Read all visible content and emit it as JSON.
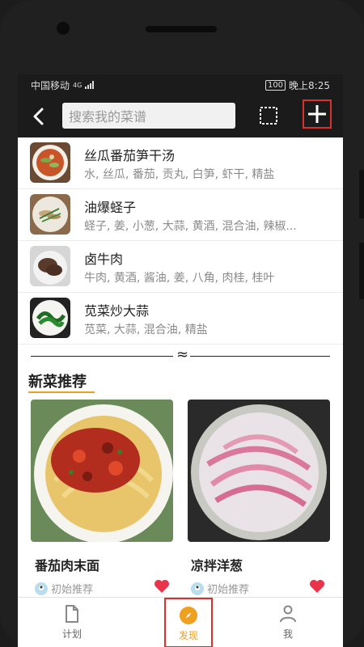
{
  "status": {
    "carrier": "中国移动",
    "network": "4G",
    "battery": "100",
    "time": "晚上8:25"
  },
  "toolbar": {
    "search_placeholder": "搜索我的菜谱"
  },
  "recipes": [
    {
      "title": "丝瓜番茄笋干汤",
      "ingredients": "水, 丝瓜, 番茄, 贡丸, 白笋, 虾干, 精盐"
    },
    {
      "title": "油爆蛏子",
      "ingredients": "蛏子, 姜, 小葱, 大蒜, 黄酒, 混合油, 辣椒..."
    },
    {
      "title": "卤牛肉",
      "ingredients": "牛肉, 黄酒, 酱油, 姜, 八角, 肉桂, 桂叶"
    },
    {
      "title": "苋菜炒大蒜",
      "ingredients": "苋菜, 大蒜, 混合油, 精盐"
    }
  ],
  "section": {
    "title": "新菜推荐"
  },
  "cards": [
    {
      "title": "番茄肉末面",
      "author": "初始推荐"
    },
    {
      "title": "凉拌洋葱",
      "author": "初始推荐"
    }
  ],
  "tabs": [
    {
      "label": "计划",
      "icon": "document-icon"
    },
    {
      "label": "发现",
      "icon": "compass-icon"
    },
    {
      "label": "我",
      "icon": "person-icon"
    }
  ],
  "colors": {
    "accent": "#f0a020",
    "highlight": "#d9322d",
    "toolbar": "#1b1b1b"
  }
}
